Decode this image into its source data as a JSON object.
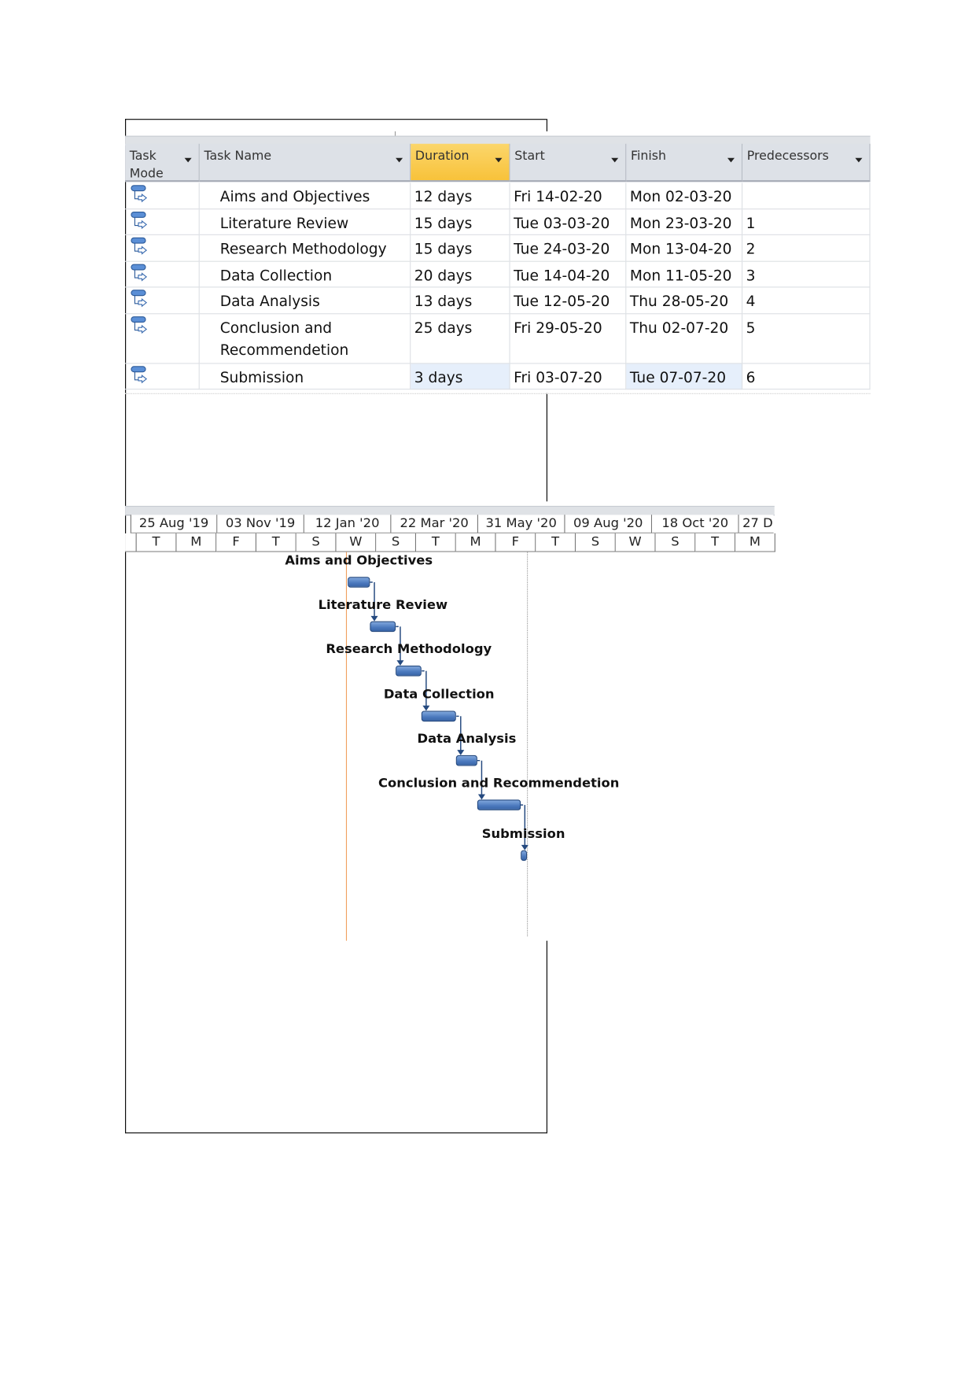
{
  "table": {
    "columns": [
      {
        "label": "Task Mode",
        "selected": false
      },
      {
        "label": "Task Name",
        "selected": false
      },
      {
        "label": "Duration",
        "selected": true
      },
      {
        "label": "Start",
        "selected": false
      },
      {
        "label": "Finish",
        "selected": false
      },
      {
        "label": "Predecessors",
        "selected": false
      }
    ],
    "rows": [
      {
        "mode_icon": "auto-scheduled-task-icon",
        "name": "Aims and Objectives",
        "duration": "12 days",
        "start": "Fri 14-02-20",
        "finish": "Mon 02-03-20",
        "predecessors": ""
      },
      {
        "mode_icon": "auto-scheduled-task-icon",
        "name": "Literature Review",
        "duration": "15 days",
        "start": "Tue 03-03-20",
        "finish": "Mon 23-03-20",
        "predecessors": "1"
      },
      {
        "mode_icon": "auto-scheduled-task-icon",
        "name": "Research Methodology",
        "duration": "15 days",
        "start": "Tue 24-03-20",
        "finish": "Mon 13-04-20",
        "predecessors": "2"
      },
      {
        "mode_icon": "auto-scheduled-task-icon",
        "name": "Data Collection",
        "duration": "20 days",
        "start": "Tue 14-04-20",
        "finish": "Mon 11-05-20",
        "predecessors": "3"
      },
      {
        "mode_icon": "auto-scheduled-task-icon",
        "name": "Data Analysis",
        "duration": "13 days",
        "start": "Tue 12-05-20",
        "finish": "Thu 28-05-20",
        "predecessors": "4"
      },
      {
        "mode_icon": "auto-scheduled-task-icon",
        "name": "Conclusion and Recommendetion",
        "duration": "25 days",
        "start": "Fri 29-05-20",
        "finish": "Thu 02-07-20",
        "predecessors": "5"
      },
      {
        "mode_icon": "auto-scheduled-task-icon",
        "name": "Submission",
        "duration": "3 days",
        "start": "Fri 03-07-20",
        "finish": "Tue 07-07-20",
        "predecessors": "6"
      }
    ]
  },
  "gantt": {
    "major_ticks": [
      "25 Aug '19",
      "03 Nov '19",
      "12 Jan '20",
      "22 Mar '20",
      "31 May '20",
      "09 Aug '20",
      "18 Oct '20",
      "27 D"
    ],
    "minor_ticks": [
      "T",
      "M",
      "F",
      "T",
      "S",
      "W",
      "S",
      "T",
      "M",
      "F",
      "T",
      "S",
      "W",
      "S",
      "T",
      "M"
    ],
    "tasks": [
      {
        "label": "Aims and Objectives",
        "start": "2020-02-14",
        "finish": "2020-03-02"
      },
      {
        "label": "Literature Review",
        "start": "2020-03-03",
        "finish": "2020-03-23"
      },
      {
        "label": "Research Methodology",
        "start": "2020-03-24",
        "finish": "2020-04-13"
      },
      {
        "label": "Data Collection",
        "start": "2020-04-14",
        "finish": "2020-05-11"
      },
      {
        "label": "Data Analysis",
        "start": "2020-05-12",
        "finish": "2020-05-28"
      },
      {
        "label": "Conclusion and Recommendetion",
        "start": "2020-05-29",
        "finish": "2020-07-02"
      },
      {
        "label": "Submission",
        "start": "2020-07-03",
        "finish": "2020-07-07"
      }
    ],
    "colors": {
      "bar": "#4a78bd",
      "link": "#24497f",
      "current_date_line": "#f0a060",
      "header_selected": "#f8c23a"
    }
  }
}
